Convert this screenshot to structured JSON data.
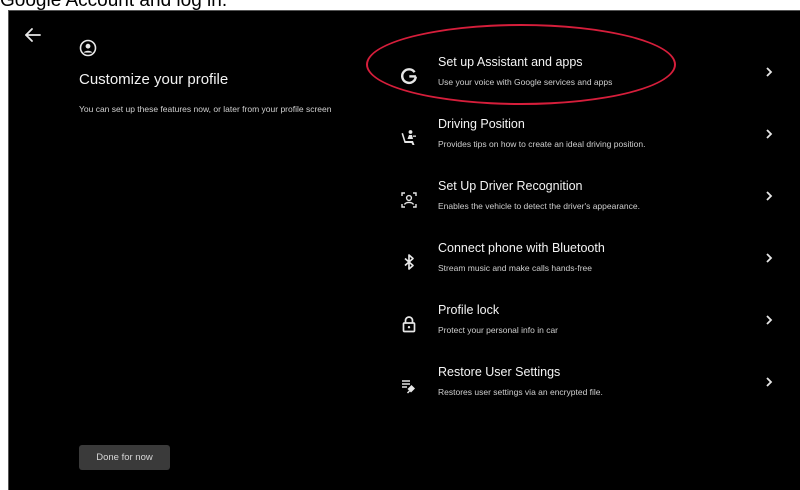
{
  "caption": "Google Account and log in.",
  "page": {
    "title": "Customize your profile",
    "description": "You can set up these features now, or later from your profile screen",
    "done_button": "Done for now"
  },
  "items": [
    {
      "title": "Set up Assistant and apps",
      "subtitle": "Use your voice with Google services and apps",
      "icon": "google-g-icon"
    },
    {
      "title": "Driving Position",
      "subtitle": "Provides tips on how to create an ideal driving position.",
      "icon": "driver-seat-icon"
    },
    {
      "title": "Set Up Driver Recognition",
      "subtitle": "Enables the vehicle to detect the driver's appearance.",
      "icon": "face-scan-icon"
    },
    {
      "title": "Connect phone with Bluetooth",
      "subtitle": "Stream music and make calls hands-free",
      "icon": "bluetooth-icon"
    },
    {
      "title": "Profile lock",
      "subtitle": "Protect your personal info in car",
      "icon": "lock-icon"
    },
    {
      "title": "Restore User Settings",
      "subtitle": "Restores user settings via an encrypted file.",
      "icon": "restore-settings-icon"
    }
  ],
  "colors": {
    "background": "#000000",
    "highlight_ring": "#d61e3b",
    "button_bg": "#3a3a3a"
  }
}
